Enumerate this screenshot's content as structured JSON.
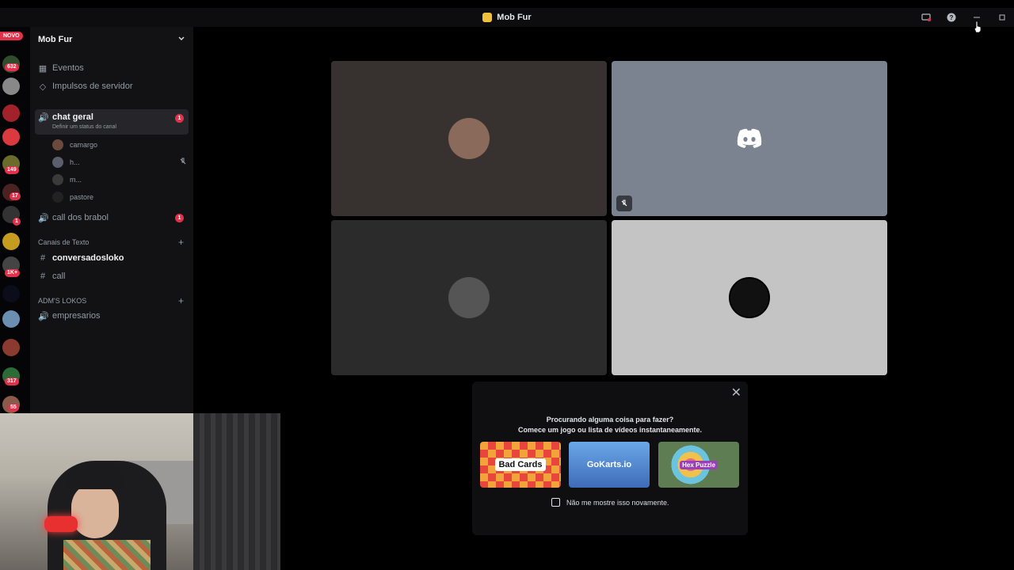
{
  "window": {
    "title": "Mob Fur",
    "icons": [
      "screen-share-icon",
      "help-icon",
      "minimize-icon",
      "maximize-icon"
    ]
  },
  "guild_rail": {
    "new_badge": "NOVO",
    "badges": [
      "632",
      "149",
      "17",
      "1",
      "1K+",
      "317",
      "55"
    ]
  },
  "server": {
    "name": "Mob Fur",
    "top_items": [
      {
        "label": "Eventos",
        "icon": "calendar-icon"
      },
      {
        "label": "Impulsos de servidor",
        "icon": "boost-icon"
      }
    ],
    "voice_active": {
      "label": "chat geral",
      "status": "Definir um status do canal",
      "notifications": "1",
      "users": [
        {
          "name": "camargo",
          "muted": false
        },
        {
          "name": "h...",
          "muted": true
        },
        {
          "name": "m...",
          "muted": false
        },
        {
          "name": "pastore",
          "muted": false
        }
      ]
    },
    "voice_other": {
      "label": "call dos brabol",
      "notifications": "1"
    },
    "text_category": "Canais de Texto",
    "text_channels": [
      {
        "label": "conversadosloko",
        "unread": true
      },
      {
        "label": "call",
        "unread": false
      }
    ],
    "adm_category": "ADM'S LOKOS",
    "adm_channels": [
      {
        "label": "empresarios"
      }
    ]
  },
  "activity_prompt": {
    "line1": "Procurando alguma coisa para fazer?",
    "line2": "Comece um jogo ou lista de vídeos instantaneamente.",
    "games": [
      {
        "title": "Bad Cards",
        "color": "#e8453c"
      },
      {
        "title": "GoKarts.io",
        "color": "#4a7bd3"
      },
      {
        "title": "Hex Puzzle",
        "color": "#5e7d52"
      }
    ],
    "dont_show": "Não me mostre isso novamente."
  },
  "colors": {
    "accent_red": "#e2324b",
    "discord_blurple_tile": "#7b8290",
    "background": "#000000"
  }
}
